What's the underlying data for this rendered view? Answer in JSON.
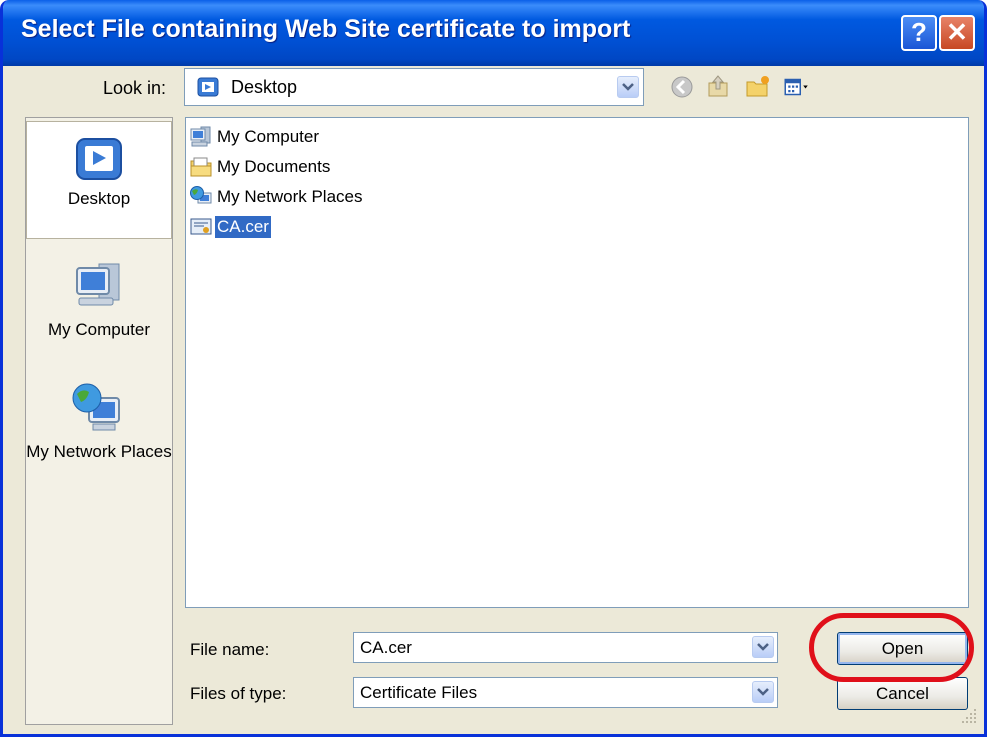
{
  "window": {
    "title": "Select File containing Web Site certificate to import",
    "help_label": "?",
    "close_label": "✕"
  },
  "toolbar": {
    "lookin_label": "Look in:",
    "lookin_value": "Desktop"
  },
  "places_bar": {
    "items": [
      {
        "label": "Desktop",
        "icon": "desktop-icon",
        "selected": true
      },
      {
        "label": "My Computer",
        "icon": "my-computer-icon"
      },
      {
        "label": "My Network Places",
        "icon": "network-places-icon"
      }
    ]
  },
  "file_list": {
    "items": [
      {
        "name": "My Computer",
        "icon": "my-computer-icon",
        "selected": false
      },
      {
        "name": "My Documents",
        "icon": "my-documents-icon",
        "selected": false
      },
      {
        "name": "My Network Places",
        "icon": "network-places-icon",
        "selected": false
      },
      {
        "name": "CA.cer",
        "icon": "certificate-icon",
        "selected": true
      }
    ]
  },
  "form": {
    "filename_label": "File name:",
    "filename_value": "CA.cer",
    "filetype_label": "Files of type:",
    "filetype_value": "Certificate Files"
  },
  "buttons": {
    "open": "Open",
    "cancel": "Cancel"
  },
  "colors": {
    "titlebar": "#0054e3",
    "highlight_ring": "#e0101a",
    "selection": "#316ac5"
  }
}
